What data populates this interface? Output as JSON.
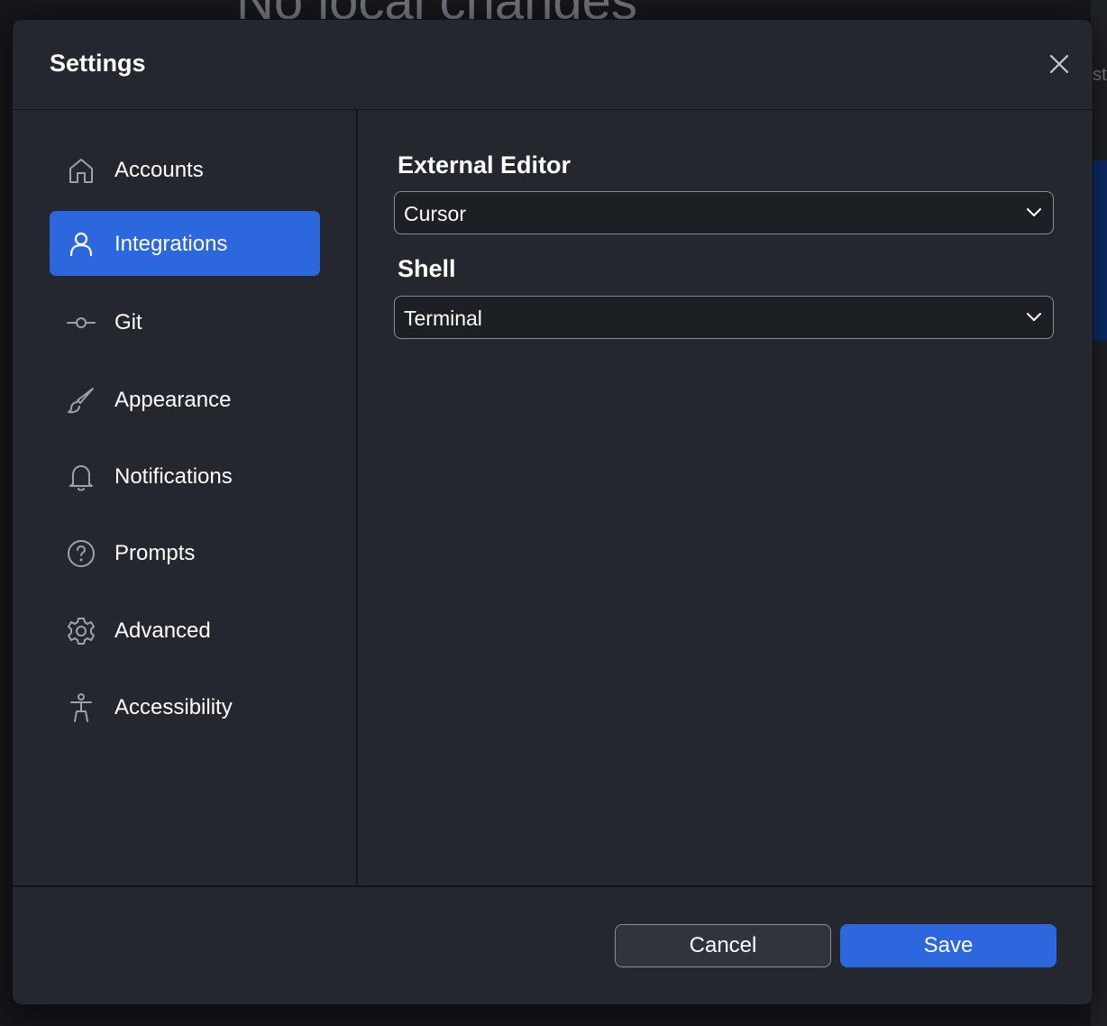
{
  "background": {
    "heading": "No local changes",
    "edge_text": "st"
  },
  "dialog": {
    "title": "Settings"
  },
  "sidebar": {
    "items": [
      {
        "label": "Accounts",
        "icon": "home-icon",
        "active": false
      },
      {
        "label": "Integrations",
        "icon": "person-icon",
        "active": true
      },
      {
        "label": "Git",
        "icon": "git-commit-icon",
        "active": false
      },
      {
        "label": "Appearance",
        "icon": "paintbrush-icon",
        "active": false
      },
      {
        "label": "Notifications",
        "icon": "bell-icon",
        "active": false
      },
      {
        "label": "Prompts",
        "icon": "question-circle-icon",
        "active": false
      },
      {
        "label": "Advanced",
        "icon": "gear-icon",
        "active": false
      },
      {
        "label": "Accessibility",
        "icon": "accessibility-icon",
        "active": false
      }
    ]
  },
  "integrations": {
    "external_editor": {
      "label": "External Editor",
      "value": "Cursor"
    },
    "shell": {
      "label": "Shell",
      "value": "Terminal"
    }
  },
  "footer": {
    "cancel_label": "Cancel",
    "save_label": "Save"
  },
  "colors": {
    "accent": "#2d67dd",
    "dialog_bg": "#24282e",
    "page_bg": "#141619"
  }
}
